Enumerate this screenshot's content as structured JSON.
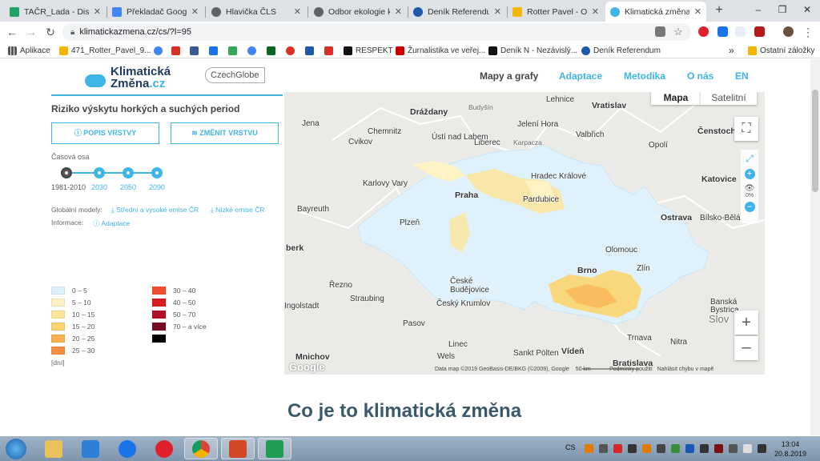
{
  "browser": {
    "tabs": [
      {
        "title": "TAČR_Lada - Disk Go",
        "color": "#1fa463"
      },
      {
        "title": "Překladač Google",
        "color": "#4285f4"
      },
      {
        "title": "Hlavička ČLS",
        "color": "#5f6368"
      },
      {
        "title": "Odbor ekologie kra",
        "color": "#5f6368"
      },
      {
        "title": "Deník Referendum",
        "color": "#1e5aa8"
      },
      {
        "title": "Rotter Pavel - Outl",
        "color": "#f2b705"
      },
      {
        "title": "Klimatická změna v",
        "color": "#3fb4e6"
      }
    ],
    "new_tab": "+",
    "window_controls": [
      "–",
      "❐",
      "✕"
    ],
    "url": "klimatickazmena.cz/cs/?l=95",
    "bookmarks": [
      {
        "label": "Aplikace",
        "color": "#555"
      },
      {
        "label": "471_Rotter_Pavel_9...",
        "color": "#f4b400"
      },
      {
        "label": "",
        "color": "#4285f4"
      },
      {
        "label": "",
        "color": "#d93025"
      },
      {
        "label": "",
        "color": "#3b5998"
      },
      {
        "label": "",
        "color": "#1a73e8"
      },
      {
        "label": "",
        "color": "#34a853"
      },
      {
        "label": "",
        "color": "#4285f4"
      },
      {
        "label": "",
        "color": "#0b6623"
      },
      {
        "label": "",
        "color": "#d93025"
      },
      {
        "label": "",
        "color": "#1e5aa8"
      },
      {
        "label": "",
        "color": "#d93025"
      },
      {
        "label": "RESPEKT",
        "color": "#111"
      },
      {
        "label": "Žurnalistika ve veřej...",
        "color": "#c00"
      },
      {
        "label": "Deník N - Nezávislý...",
        "color": "#111"
      },
      {
        "label": "Deník Referendum",
        "color": "#1e5aa8"
      },
      {
        "label": "Ostatní záložky",
        "color": "#f4b400"
      }
    ],
    "bookmarks_more": "»"
  },
  "site": {
    "logo_line1": "Klimatická",
    "logo_line2a": "Změna",
    "logo_line2b": ".cz",
    "partner": "CzechGlobe",
    "nav": [
      "Mapy a grafy",
      "Adaptace",
      "Metodika",
      "O nás",
      "EN"
    ]
  },
  "panel": {
    "title": "Riziko výskytu horkých a suchých period",
    "btn_description": "ⓘ POPIS VRSTVY",
    "btn_change": "≋ ZMĚNIT VRSTVU",
    "timeline_label": "Časová osa",
    "timeline": [
      "1981-2010",
      "2030",
      "2050",
      "2090"
    ],
    "models_label": "Globální modely:",
    "model_high": "Střední a vysoké emise ČR",
    "model_low": "Nízké emise ČR",
    "info_label": "Informace:",
    "info_link": "Adaptace",
    "legend": [
      {
        "label": "0 – 5",
        "color": "#dff2fb"
      },
      {
        "label": "5 – 10",
        "color": "#fdf3c4"
      },
      {
        "label": "10 – 15",
        "color": "#fde59a"
      },
      {
        "label": "15 – 20",
        "color": "#fcd46f"
      },
      {
        "label": "20 – 25",
        "color": "#fbb150"
      },
      {
        "label": "25 – 30",
        "color": "#f88e42"
      },
      {
        "label": "30 – 40",
        "color": "#f0502d"
      },
      {
        "label": "40 – 50",
        "color": "#d91c1c"
      },
      {
        "label": "50 – 70",
        "color": "#b40f2a"
      },
      {
        "label": "70 – a více",
        "color": "#7a0a24"
      },
      {
        "label": "",
        "color": "#000000"
      }
    ],
    "unit": "[dní]"
  },
  "map": {
    "type_map": "Mapa",
    "type_sat": "Satelitní",
    "zoom_pct": "0%",
    "zoom_in": "+",
    "zoom_out": "–",
    "fullscreen": "⛶",
    "cities": [
      "Lehnice",
      "Vratislav",
      "Dráždany",
      "Budyšín",
      "Jena",
      "Chemnitz",
      "Ústí nad Labem",
      "Liberec",
      "Jelení Hora",
      "Valbřich",
      "Karpacza",
      "Čenstochová",
      "Opolí",
      "Cvikov",
      "Karlovy Vary",
      "Hradec Králové",
      "Pardubice",
      "Praha",
      "Katovice",
      "Bayreuth",
      "Plzeň",
      "Ostrava",
      "Bílsko-Bělá",
      "Olomouc",
      "berk",
      "Řezno",
      "Brno",
      "Zlín",
      "České Budějovice",
      "Straubing",
      "Ingolstadt",
      "Český Krumlov",
      "Banská Bystrica",
      "Slov",
      "Pasov",
      "Trnava",
      "Nitra",
      "Linec",
      "Mnichov",
      "Wels",
      "Sankt Pölten",
      "Vídeň",
      "Bratislava"
    ],
    "attribution": "Data map ©2019 GeoBasis-DE/BKG (©2009), Google",
    "scale": "50 km",
    "terms": "Podmínky použití",
    "report": "Nahlásit chybu v mapě",
    "google": "Google"
  },
  "page": {
    "heading": "Co je to klimatická změna"
  },
  "taskbar": {
    "lang": "CS",
    "time": "13:04",
    "date": "20.8.2019",
    "apps": [
      {
        "color": "#e8c15a"
      },
      {
        "color": "#2e7fd6"
      },
      {
        "color": "#1a73e8"
      },
      {
        "color": "#e0202a"
      },
      {
        "color": "#4caf50"
      },
      {
        "color": "#d24726"
      },
      {
        "color": "#1f9d55"
      }
    ]
  }
}
